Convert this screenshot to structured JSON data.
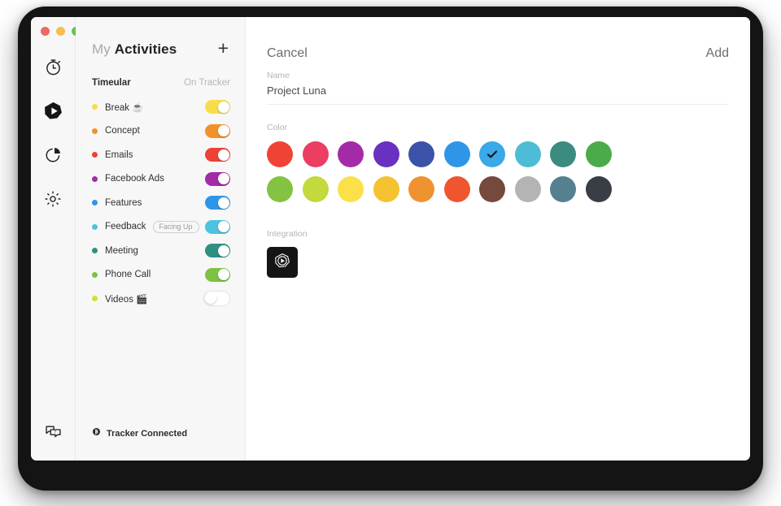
{
  "window": {
    "traffic_lights": [
      "close",
      "minimize",
      "zoom"
    ]
  },
  "rail": {
    "items": [
      {
        "icon": "stopwatch-icon",
        "active": false
      },
      {
        "icon": "play-polygon-icon",
        "active": true
      },
      {
        "icon": "pie-chart-icon",
        "active": false
      },
      {
        "icon": "gear-icon",
        "active": false
      }
    ],
    "bottom": {
      "icon": "help-chat-icon"
    }
  },
  "sidebar": {
    "title_light": "My",
    "title_bold": "Activities",
    "add_button": "+",
    "group_label": "Timeular",
    "on_tracker_label": "On Tracker",
    "activities": [
      {
        "name": "Break ☕",
        "color": "#f7dd4a",
        "toggle": "on",
        "track_color": "#f7dd4a",
        "badge": ""
      },
      {
        "name": "Concept",
        "color": "#f0922b",
        "toggle": "on",
        "track_color": "#f0922b",
        "badge": ""
      },
      {
        "name": "Emails",
        "color": "#ef4136",
        "toggle": "on",
        "track_color": "#ef4136",
        "badge": ""
      },
      {
        "name": "Facebook Ads",
        "color": "#a32ba8",
        "toggle": "on",
        "track_color": "#a32ba8",
        "badge": ""
      },
      {
        "name": "Features",
        "color": "#2e96e8",
        "toggle": "on",
        "track_color": "#2e96e8",
        "badge": ""
      },
      {
        "name": "Feedback",
        "color": "#4dc3e0",
        "toggle": "on",
        "track_color": "#4dc3e0",
        "badge": "Facing Up"
      },
      {
        "name": "Meeting",
        "color": "#2f8f81",
        "toggle": "on",
        "track_color": "#2f8f81",
        "badge": ""
      },
      {
        "name": "Phone Call",
        "color": "#7dc242",
        "toggle": "on",
        "track_color": "#7dc242",
        "badge": ""
      },
      {
        "name": "Videos 🎬",
        "color": "#d4df36",
        "toggle": "off",
        "track_color": "#ffffff",
        "badge": ""
      }
    ],
    "footer": {
      "icon": "bluetooth-icon",
      "status_text": "Tracker Connected"
    }
  },
  "main": {
    "cancel_label": "Cancel",
    "add_label": "Add",
    "name_label": "Name",
    "name_value": "Project Luna",
    "name_placeholder": "Name",
    "color_label": "Color",
    "selected_color": "#39a9e8",
    "colors_row1": [
      "#ef4435",
      "#ec3d63",
      "#a32ba8",
      "#6a30c0",
      "#3c52a8",
      "#2e96e8",
      "#39a9e8",
      "#4dbcd6",
      "#3c8b81",
      "#4bab4b"
    ],
    "colors_row2": [
      "#84c241",
      "#c3d93c",
      "#fbe04a",
      "#f5c232",
      "#ef9330",
      "#ef5630",
      "#75493c",
      "#b4b4b4",
      "#55808f",
      "#383d46"
    ],
    "integration_label": "Integration",
    "integration_tile_icon": "timeular-play-icon"
  }
}
